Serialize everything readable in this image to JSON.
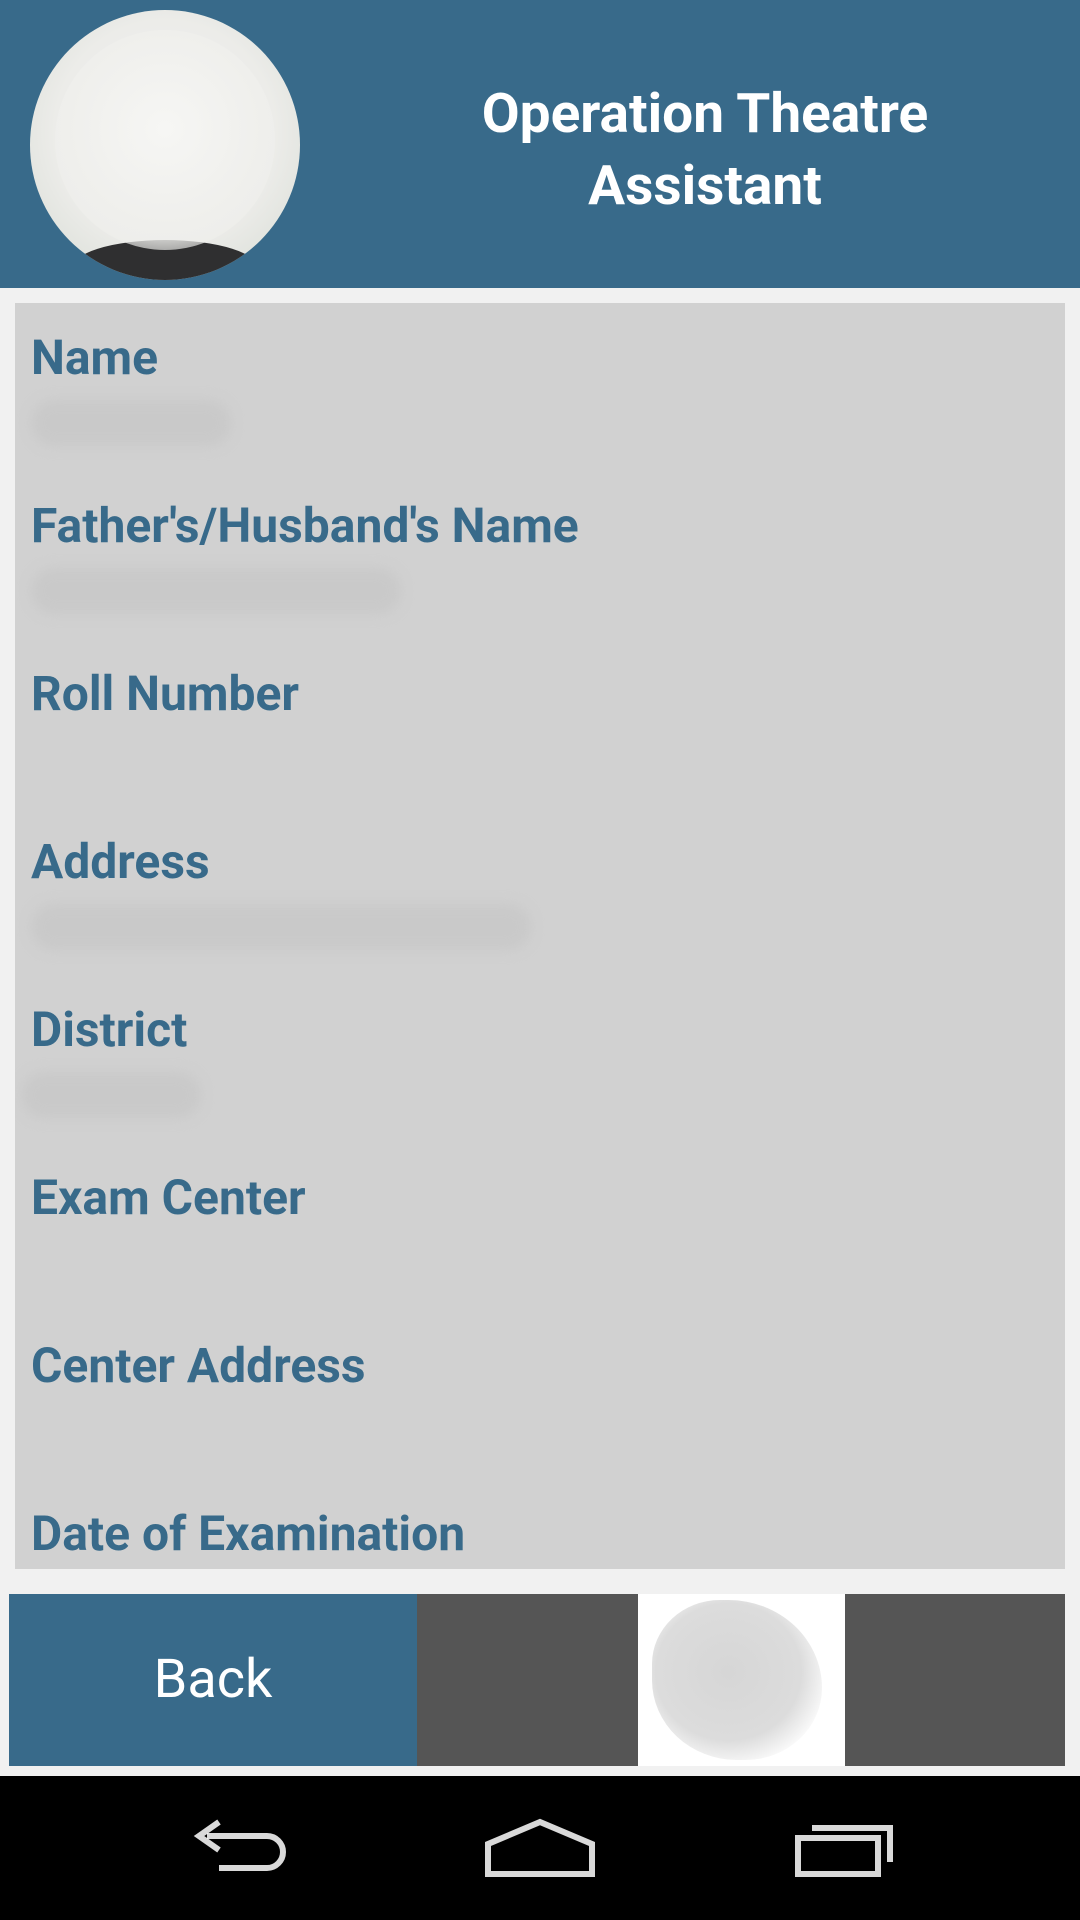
{
  "header": {
    "title_line1": "Operation Theatre",
    "title_line2": "Assistant"
  },
  "fields": [
    {
      "label": "Name",
      "value": ""
    },
    {
      "label": "Father's/Husband's  Name",
      "value": ""
    },
    {
      "label": "Roll Number",
      "value": ""
    },
    {
      "label": "Address",
      "value": ""
    },
    {
      "label": "District",
      "value": ""
    },
    {
      "label": "Exam Center",
      "value": ""
    },
    {
      "label": "Center Address",
      "value": ""
    },
    {
      "label": "Date of Examination",
      "value": ""
    }
  ],
  "footer": {
    "back_label": "Back"
  },
  "navbar": {
    "items": [
      "back-icon",
      "home-icon",
      "recent-apps-icon"
    ]
  },
  "colors": {
    "primary": "#386a8a",
    "panel": "#d1d1d1",
    "dark_block": "#555555",
    "page_bg": "#f1f1f1"
  }
}
